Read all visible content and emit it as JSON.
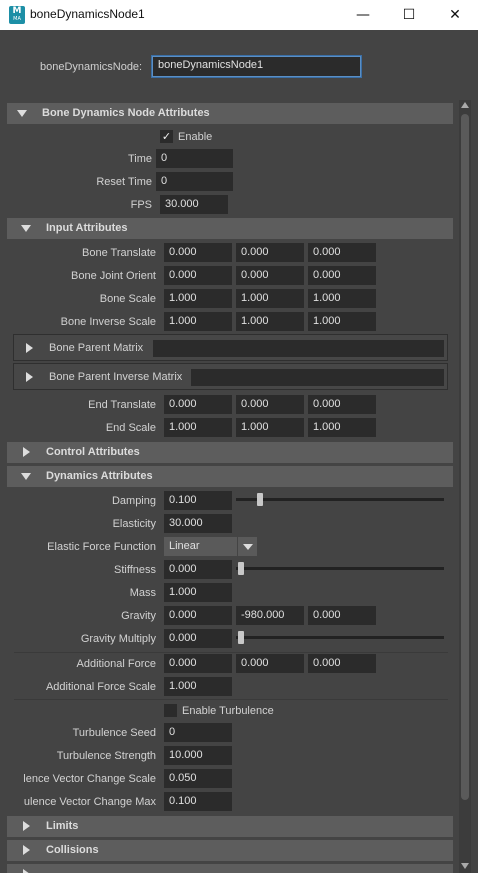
{
  "window": {
    "title": "boneDynamicsNode1",
    "minimize": "—",
    "maximize": "☐",
    "close": "✕"
  },
  "node": {
    "label": "boneDynamicsNode:",
    "value": "boneDynamicsNode1"
  },
  "sections": {
    "main": {
      "title": "Bone Dynamics Node Attributes"
    },
    "input": {
      "title": "Input Attributes"
    },
    "control": {
      "title": "Control Attributes"
    },
    "dynamics": {
      "title": "Dynamics Attributes"
    },
    "limits": {
      "title": "Limits"
    },
    "collisions": {
      "title": "Collisions"
    }
  },
  "main_attrs": {
    "enable": "Enable",
    "time_label": "Time",
    "time": "0",
    "reset_label": "Reset Time",
    "reset": "0",
    "fps_label": "FPS",
    "fps": "30.000"
  },
  "input_attrs": {
    "bone_translate": {
      "label": "Bone Translate",
      "v": [
        "0.000",
        "0.000",
        "0.000"
      ]
    },
    "bone_joint_orient": {
      "label": "Bone Joint Orient",
      "v": [
        "0.000",
        "0.000",
        "0.000"
      ]
    },
    "bone_scale": {
      "label": "Bone Scale",
      "v": [
        "1.000",
        "1.000",
        "1.000"
      ]
    },
    "bone_inverse_scale": {
      "label": "Bone Inverse Scale",
      "v": [
        "1.000",
        "1.000",
        "1.000"
      ]
    },
    "bone_parent_matrix": "Bone Parent Matrix",
    "bone_parent_inverse_matrix": "Bone Parent Inverse Matrix",
    "end_translate": {
      "label": "End Translate",
      "v": [
        "0.000",
        "0.000",
        "0.000"
      ]
    },
    "end_scale": {
      "label": "End Scale",
      "v": [
        "1.000",
        "1.000",
        "1.000"
      ]
    }
  },
  "dynamics_attrs": {
    "damping": {
      "label": "Damping",
      "value": "0.100",
      "slider": 0.1
    },
    "elasticity": {
      "label": "Elasticity",
      "value": "30.000"
    },
    "elastic_force_function": {
      "label": "Elastic Force Function",
      "value": "Linear"
    },
    "stiffness": {
      "label": "Stiffness",
      "value": "0.000",
      "slider": 0.0
    },
    "mass": {
      "label": "Mass",
      "value": "1.000"
    },
    "gravity": {
      "label": "Gravity",
      "v": [
        "0.000",
        "-980.000",
        "0.000"
      ]
    },
    "gravity_multiply": {
      "label": "Gravity Multiply",
      "value": "0.000",
      "slider": 0.0
    },
    "additional_force": {
      "label": "Additional Force",
      "v": [
        "0.000",
        "0.000",
        "0.000"
      ]
    },
    "additional_force_scale": {
      "label": "Additional Force Scale",
      "value": "1.000"
    },
    "enable_turbulence": "Enable Turbulence",
    "turbulence_seed": {
      "label": "Turbulence Seed",
      "value": "0"
    },
    "turbulence_strength": {
      "label": "Turbulence Strength",
      "value": "10.000"
    },
    "turbulence_vector_change_scale": {
      "label": "lence Vector Change Scale",
      "value": "0.050"
    },
    "turbulence_vector_change_max": {
      "label": "ulence Vector Change Max",
      "value": "0.100"
    }
  }
}
